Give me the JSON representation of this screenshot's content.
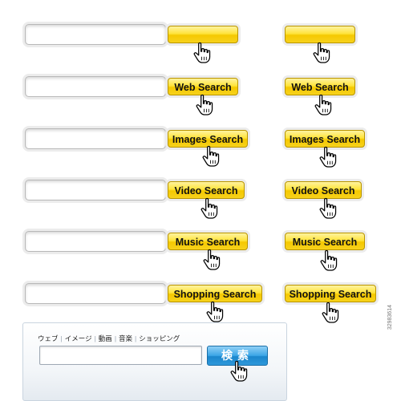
{
  "buttons": {
    "web": "Web Search",
    "images": "Images Search",
    "video": "Video Search",
    "music": "Music Search",
    "shopping": "Shopping Search"
  },
  "jp": {
    "links": [
      "ウェブ",
      "イメージ",
      "動画",
      "音楽",
      "ショッピング"
    ],
    "search_button": "検索"
  },
  "side_text": "32983614",
  "colors": {
    "button_yellow": "#f5c800",
    "button_blue": "#1a86cc"
  },
  "icons": {
    "cursor": "hand-pointer-icon"
  }
}
